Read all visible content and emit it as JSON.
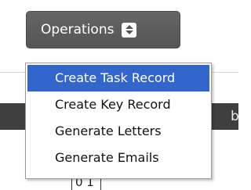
{
  "toolbar": {
    "operations_label": "Operations",
    "operations_icon": "up-down-arrows-icon"
  },
  "menu": {
    "items": [
      {
        "label": "Create Task Record",
        "selected": true
      },
      {
        "label": "Create Key Record",
        "selected": false
      },
      {
        "label": "Generate Letters",
        "selected": false
      },
      {
        "label": "Generate Emails",
        "selected": false
      }
    ],
    "highlight_color": "#3366cc"
  },
  "background": {
    "header_fragment": "b",
    "cell_fragment": "0 1"
  },
  "colors": {
    "button_bg": "#5c5c5c",
    "header_bg": "#3f3f3f",
    "menu_border": "#9a9a9a"
  }
}
